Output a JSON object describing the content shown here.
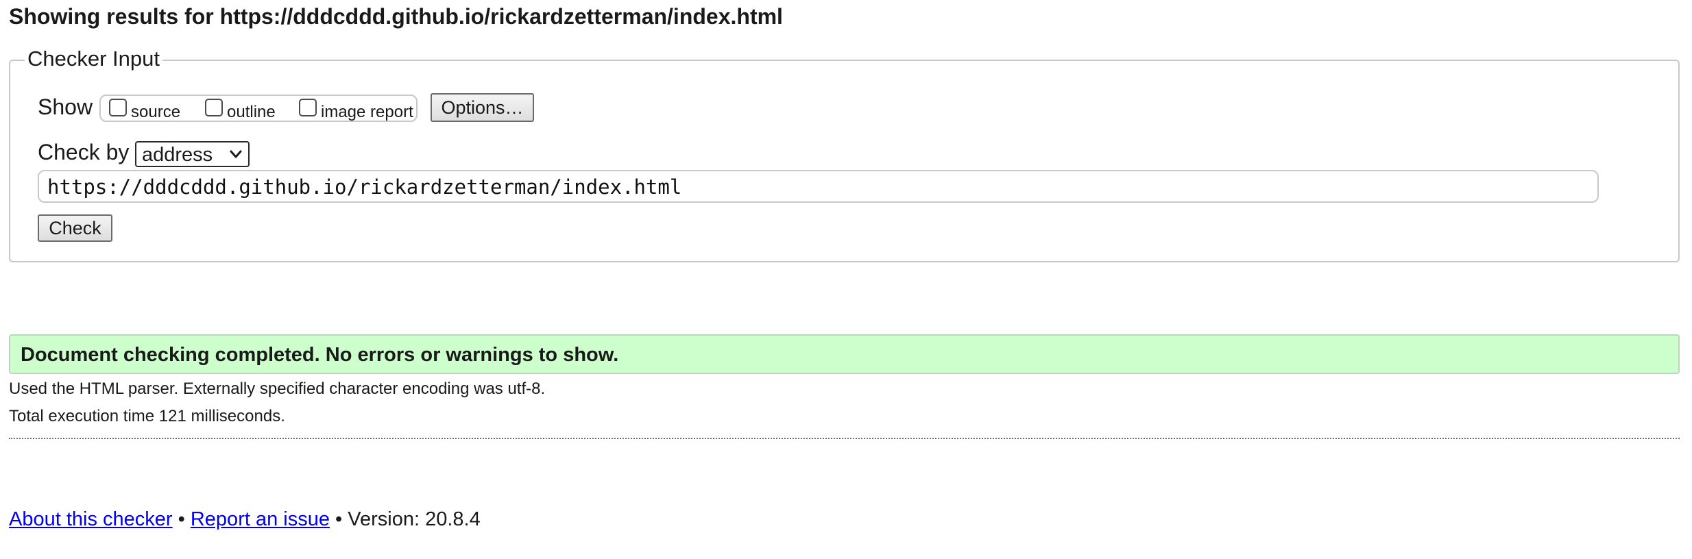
{
  "page": {
    "heading": "Showing results for https://dddcddd.github.io/rickardzetterman/index.html"
  },
  "checker": {
    "legend": "Checker Input",
    "show_label": "Show",
    "show_options": [
      {
        "label": "source",
        "checked": false
      },
      {
        "label": "outline",
        "checked": false
      },
      {
        "label": "image report",
        "checked": false
      }
    ],
    "options_button_label": "Options…",
    "check_by_label": "Check by",
    "check_by_selected": "address",
    "address_value": "https://dddcddd.github.io/rickardzetterman/index.html",
    "check_button_label": "Check"
  },
  "results": {
    "success_message": "Document checking completed. No errors or warnings to show.",
    "parser_info": "Used the HTML parser. Externally specified character encoding was utf-8.",
    "execution_time": "Total execution time 121 milliseconds."
  },
  "footer": {
    "about_link": "About this checker",
    "separator": "•",
    "report_link": "Report an issue",
    "version_text": "Version: 20.8.4"
  },
  "colors": {
    "success_background": "#ccffcc",
    "link": "#0000ee"
  },
  "icons": {
    "select_arrow": "chevron-down-icon"
  }
}
